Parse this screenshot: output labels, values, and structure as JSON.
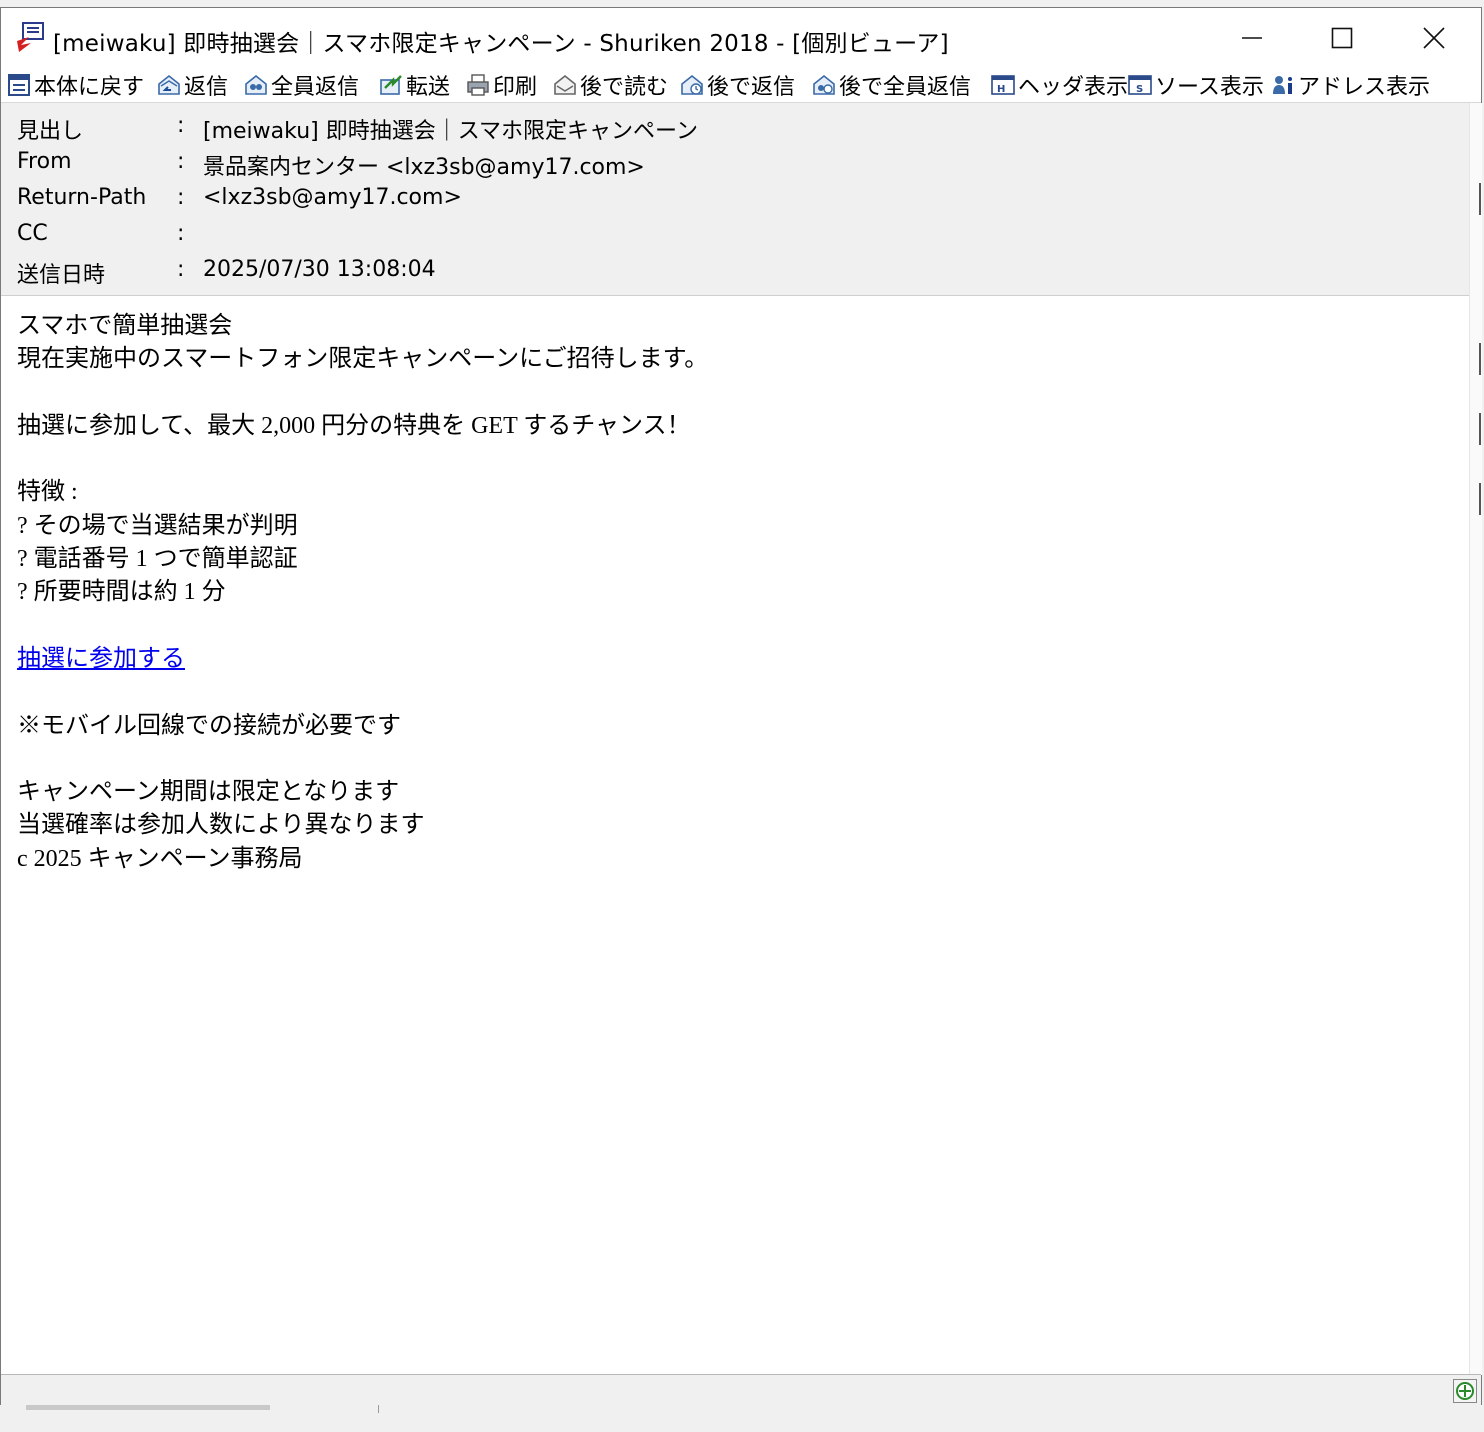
{
  "window": {
    "title": "[meiwaku] 即時抽選会｜スマホ限定キャンペーン - Shuriken 2018 - [個別ビューア]",
    "controls": {
      "minimize": "—",
      "maximize": "☐",
      "close": "✕"
    }
  },
  "toolbar": {
    "items": [
      {
        "label": "本体に戻す",
        "icon": "return-to-main-icon"
      },
      {
        "label": "返信",
        "icon": "reply-icon"
      },
      {
        "label": "全員返信",
        "icon": "reply-all-icon"
      },
      {
        "label": "転送",
        "icon": "forward-icon"
      },
      {
        "label": "印刷",
        "icon": "print-icon"
      },
      {
        "label": "後で読む",
        "icon": "read-later-icon"
      },
      {
        "label": "後で返信",
        "icon": "reply-later-icon"
      },
      {
        "label": "後で全員返信",
        "icon": "reply-all-later-icon"
      },
      {
        "label": "ヘッダ表示",
        "icon": "header-view-icon"
      },
      {
        "label": "ソース表示",
        "icon": "source-view-icon"
      },
      {
        "label": "アドレス表示",
        "icon": "address-view-icon"
      }
    ]
  },
  "headers": {
    "colon": ":",
    "subject": {
      "label": "見出し",
      "value": "[meiwaku] 即時抽選会｜スマホ限定キャンペーン"
    },
    "from": {
      "label": "From",
      "value": "景品案内センター <lxz3sb@amy17.com>"
    },
    "return_path": {
      "label": "Return-Path",
      "value": "<lxz3sb@amy17.com>"
    },
    "cc": {
      "label": "CC",
      "value": ""
    },
    "date": {
      "label": "送信日時",
      "value": "2025/07/30 13:08:04"
    }
  },
  "body": {
    "line1": "スマホで簡単抽選会",
    "line2": "現在実施中のスマートフォン限定キャンペーンにご招待します。",
    "line3": "抽選に参加して、最大 2,000 円分の特典を GET するチャンス！",
    "line4": "特徴 :",
    "line5": "? その場で当選結果が判明",
    "line6": "? 電話番号 1 つで簡単認証",
    "line7": "? 所要時間は約 1 分",
    "link": "抽選に参加する",
    "line8": "※モバイル回線での接続が必要です",
    "line9": "キャンペーン期間は限定となります",
    "line10": "当選確率は参加人数により異なります",
    "line11": "c 2025 キャンペーン事務局"
  }
}
